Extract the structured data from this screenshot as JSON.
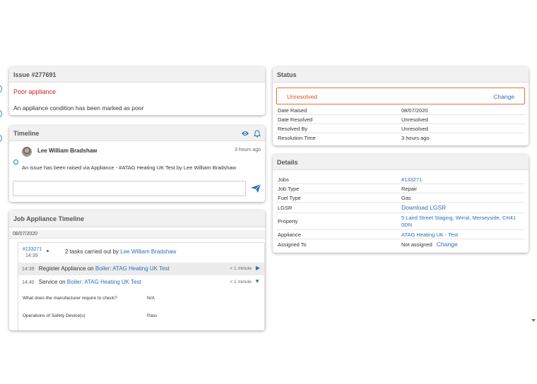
{
  "issue": {
    "header": "Issue #277691",
    "title": "Poor appliance",
    "description": "An appliance condition has been marked as poor"
  },
  "timeline": {
    "header": "Timeline",
    "author": "Lee William Bradshaw",
    "time_ago": "3 hours ago",
    "message": "An issue has been raised via Appliance - #ATAG Heating UK Test by Lee William Bradshaw",
    "input_value": "",
    "icons": [
      "eye-icon",
      "bell-icon",
      "send-icon"
    ]
  },
  "job_appliance_timeline": {
    "header": "Job Appliance Timeline",
    "date": "08/07/2020",
    "job_number": "#133271",
    "job_time": "14:39",
    "summary_prefix": "2 tasks carried out by",
    "summary_user": "Lee William Bradshaw",
    "tasks": [
      {
        "time": "14:39",
        "action": "Register Appliance on",
        "target": "Boiler: ATAG Heating UK Test",
        "duration": "< 1 minute",
        "caret": "▶"
      },
      {
        "time": "14:40",
        "action": "Service on",
        "target": "Boiler: ATAG Heating UK Test",
        "duration": "< 1 minute",
        "caret": "▼"
      }
    ],
    "answers": [
      {
        "question": "What does the manufacturer require to check?",
        "answer": "N/A"
      },
      {
        "question": "Operations of Safety Device(s)",
        "answer": "Pass"
      }
    ]
  },
  "status": {
    "header": "Status",
    "value": "Unresolved",
    "change_label": "Change",
    "rows": [
      {
        "label": "Date Raised",
        "value": "08/07/2020"
      },
      {
        "label": "Date Resolved",
        "value": "Unresolved"
      },
      {
        "label": "Resolved By",
        "value": "Unresolved"
      },
      {
        "label": "Resolution Time",
        "value": "3 hours ago"
      }
    ]
  },
  "details": {
    "header": "Details",
    "jobs_label": "Jobs",
    "jobs_value": "#133271",
    "job_type_label": "Job Type",
    "job_type_value": "Repair",
    "fuel_type_label": "Fuel Type",
    "fuel_type_value": "Gas",
    "lgsr_label": "LGSR",
    "lgsr_value": "Download LGSR",
    "property_label": "Property",
    "property_value": "5 Laird Street Staging, Wirral, Merseyside, CH41 0DN",
    "appliance_label": "Appliance",
    "appliance_value": "ATAG Heating UK - Test",
    "assigned_label": "Assigned To",
    "assigned_value": "Not assigned",
    "assigned_change": "Change"
  },
  "colors": {
    "link": "#2f6fb3",
    "danger": "#d11f1f",
    "status_orange": "#d9541e"
  }
}
